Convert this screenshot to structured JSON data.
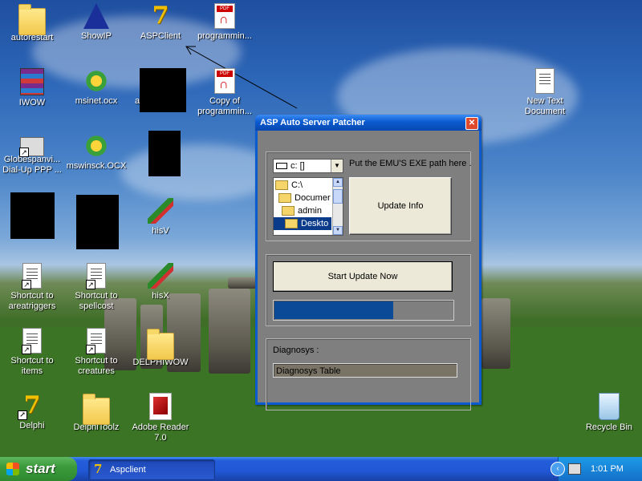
{
  "desktop": {
    "icons": [
      {
        "label": "autorestart",
        "icon": "folder-icon"
      },
      {
        "label": "ShowIP",
        "icon": "blue-triangle-icon"
      },
      {
        "label": "ASPClient",
        "icon": "delphi-icon"
      },
      {
        "label": "programmin...",
        "icon": "pdf-icon"
      },
      {
        "label": "IWOW",
        "icon": "rar-archive-icon"
      },
      {
        "label": "msinet.ocx",
        "icon": "activex-gear-icon"
      },
      {
        "label": "a",
        "icon": "redacted"
      },
      {
        "label": "Copy of programmin...",
        "icon": "pdf-icon"
      },
      {
        "label": "New Text Document",
        "icon": "text-document-icon"
      },
      {
        "label": "Globespanvi... Dial-Up PPP ...",
        "icon": "network-connection-icon"
      },
      {
        "label": "mswinsck.OCX",
        "icon": "activex-gear-icon"
      },
      {
        "label": "hisV",
        "icon": "pen-script-icon"
      },
      {
        "label": "Shortcut to areatriggers",
        "icon": "text-document-icon"
      },
      {
        "label": "Shortcut to spellcost",
        "icon": "text-document-icon"
      },
      {
        "label": "hisX",
        "icon": "pen-script-icon"
      },
      {
        "label": "Shortcut to items",
        "icon": "text-document-icon"
      },
      {
        "label": "Shortcut to creatures",
        "icon": "text-document-icon"
      },
      {
        "label": "DELPHIWOW",
        "icon": "folder-icon"
      },
      {
        "label": "Delphi",
        "icon": "delphi-icon"
      },
      {
        "label": "DelphiToolz",
        "icon": "folder-icon"
      },
      {
        "label": "Adobe Reader 7.0",
        "icon": "acrobat-icon"
      },
      {
        "label": "Recycle Bin",
        "icon": "recycle-bin-icon"
      }
    ],
    "shortcut_marker": "↗"
  },
  "window": {
    "title": "ASP Auto Server Patcher",
    "close_glyph": "✕",
    "drive_combo": {
      "value": "c: []",
      "arrow": "▼"
    },
    "directories": [
      {
        "label": "C:\\",
        "selected": false
      },
      {
        "label": "Documer",
        "selected": false
      },
      {
        "label": "admin",
        "selected": false
      },
      {
        "label": "Deskto",
        "selected": true
      }
    ],
    "path_hint": "Put the EMU'S EXE path here .",
    "update_info_label": "Update Info",
    "start_update_label": "Start Update Now",
    "progress_percent": 67,
    "diagnosys_label": "Diagnosys :",
    "diagnosys_table": "Diagnosys Table"
  },
  "taskbar": {
    "start_label": "start",
    "task_icon_glyph": "7",
    "task_label": "Aspclient",
    "tray_chevron": "‹",
    "clock": "1:01 PM"
  }
}
